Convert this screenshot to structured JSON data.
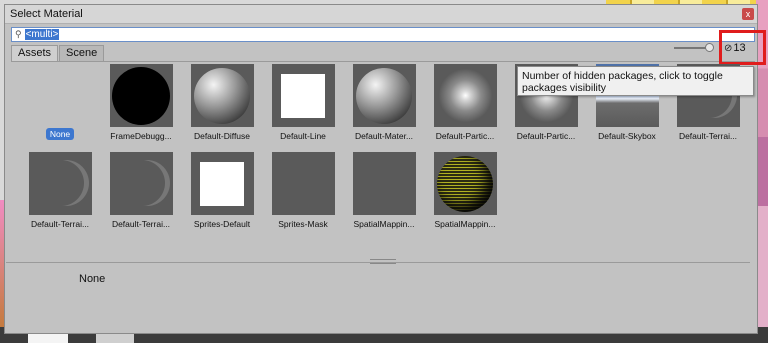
{
  "window": {
    "title": "Select Material",
    "close_glyph": "x"
  },
  "search": {
    "icon": "search-icon",
    "value": "<multi>"
  },
  "tabs": [
    {
      "label": "Assets",
      "active": true
    },
    {
      "label": "Scene",
      "active": false
    }
  ],
  "hidden_packages": {
    "icon": "eye-slash-icon",
    "count": "13",
    "tooltip": "Number of hidden packages, click to toggle packages visibility"
  },
  "items": [
    {
      "label": "None",
      "kind": "none",
      "selected": true
    },
    {
      "label": "FrameDebugg...",
      "kind": "black-circle"
    },
    {
      "label": "Default-Diffuse",
      "kind": "sphere"
    },
    {
      "label": "Default-Line",
      "kind": "white-square"
    },
    {
      "label": "Default-Mater...",
      "kind": "sphere"
    },
    {
      "label": "Default-Partic...",
      "kind": "glow"
    },
    {
      "label": "Default-Partic...",
      "kind": "glow"
    },
    {
      "label": "Default-Skybox",
      "kind": "skybox"
    },
    {
      "label": "Default-Terrai...",
      "kind": "crescent"
    },
    {
      "label": "Default-Terrai...",
      "kind": "crescent"
    },
    {
      "label": "Default-Terrai...",
      "kind": "crescent"
    },
    {
      "label": "Sprites-Default",
      "kind": "white-square"
    },
    {
      "label": "Sprites-Mask",
      "kind": "plain"
    },
    {
      "label": "SpatialMappin...",
      "kind": "plain"
    },
    {
      "label": "SpatialMappin...",
      "kind": "wire-sphere"
    }
  ],
  "preview": {
    "label": "None"
  },
  "colors": {
    "accent": "#3d77cf",
    "highlight": "#e01c1c"
  }
}
